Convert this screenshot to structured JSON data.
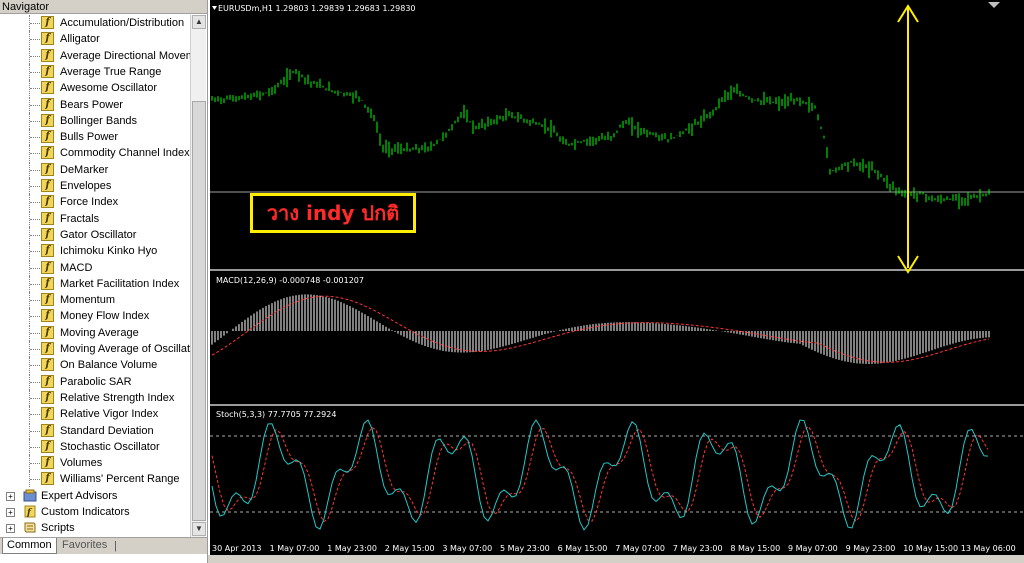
{
  "navigator": {
    "title": "Navigator",
    "indicators": [
      "Accumulation/Distribution",
      "Alligator",
      "Average Directional Movement Index",
      "Average True Range",
      "Awesome Oscillator",
      "Bears Power",
      "Bollinger Bands",
      "Bulls Power",
      "Commodity Channel Index",
      "DeMarker",
      "Envelopes",
      "Force Index",
      "Fractals",
      "Gator Oscillator",
      "Ichimoku Kinko Hyo",
      "MACD",
      "Market Facilitation Index",
      "Momentum",
      "Money Flow Index",
      "Moving Average",
      "Moving Average of Oscillator",
      "On Balance Volume",
      "Parabolic SAR",
      "Relative Strength Index",
      "Relative Vigor Index",
      "Standard Deviation",
      "Stochastic Oscillator",
      "Volumes",
      "Williams' Percent Range"
    ],
    "indicator_icon": "f",
    "folders": [
      {
        "label": "Expert Advisors",
        "icon": "expert-advisors-icon"
      },
      {
        "label": "Custom Indicators",
        "icon": "custom-indicators-icon"
      },
      {
        "label": "Scripts",
        "icon": "scripts-icon"
      }
    ],
    "expand_glyph": "+",
    "tabs": {
      "common": "Common",
      "favorites": "Favorites",
      "separator": "|"
    },
    "scroll_up": "▲",
    "scroll_down": "▼"
  },
  "chart": {
    "symbol_label": "EURUSDm,H1  1.29803 1.29839 1.29683 1.29830",
    "macd_label": "MACD(12,26,9) -0.000748 -0.001207",
    "stoch_label": "Stoch(5,3,3) 77.7705 77.2924",
    "annotation": "วาง indy ปกติ",
    "x_ticks": [
      "30 Apr 2013",
      "1 May 07:00",
      "1 May 23:00",
      "2 May 15:00",
      "3 May 07:00",
      "5 May 23:00",
      "6 May 15:00",
      "7 May 07:00",
      "7 May 23:00",
      "8 May 15:00",
      "9 May 07:00",
      "9 May 23:00",
      "10 May 15:00",
      "13 May 06:00"
    ],
    "colors": {
      "background": "#000000",
      "candles": "#00ff00",
      "macd_histogram": "#ffffff",
      "macd_signal": "#ff3333",
      "stoch_main": "#22c8c8",
      "stoch_signal": "#ff3333",
      "annotation_border": "#ffee00",
      "annotation_text": "#ff2a2a",
      "arrow": "#ffee00"
    }
  }
}
